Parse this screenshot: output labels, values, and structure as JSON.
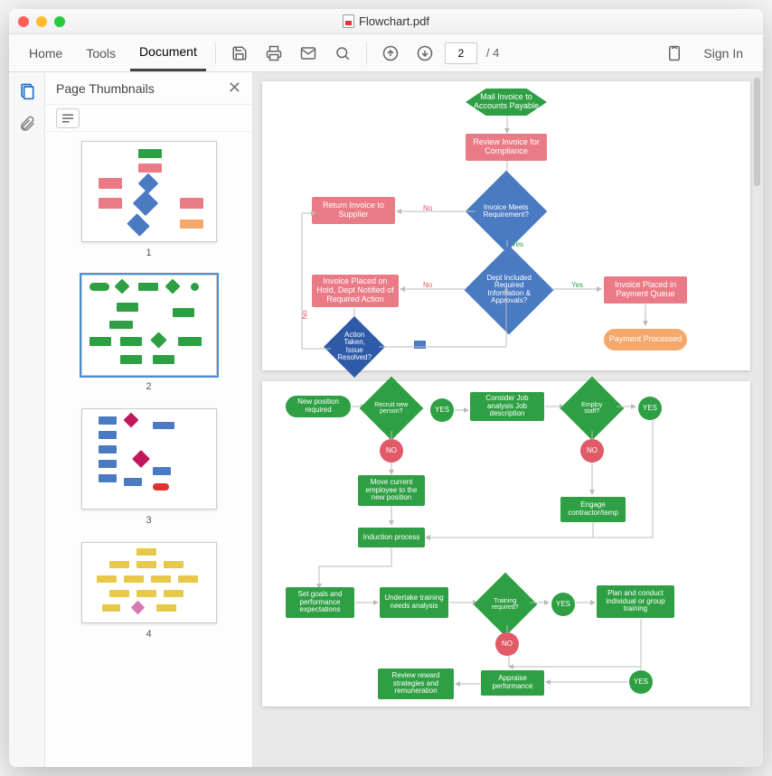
{
  "window": {
    "title": "Flowchart.pdf"
  },
  "nav": {
    "home": "Home",
    "tools": "Tools",
    "document": "Document",
    "signin": "Sign In"
  },
  "pager": {
    "current": "2",
    "total": "/ 4"
  },
  "sidebar": {
    "title": "Page Thumbnails"
  },
  "thumbs": {
    "n1": "1",
    "n2": "2",
    "n3": "3",
    "n4": "4"
  },
  "flow1": {
    "mail": "Mail Invoice to Accounts Payable",
    "review": "Review Invoice for Compliance",
    "return": "Return Invoice to Supplier",
    "meets": "Invoice Meets Requirement?",
    "hold": "Invoice Placed on Hold, Dept Notified of Required Action",
    "dept": "Dept Included Required Information & Approvals?",
    "queue": "Invoice Placed in Payment Queue",
    "action": "Action Taken, Issue Resolved?",
    "processed": "Payment Processed",
    "yes": "Yes",
    "no": "No"
  },
  "flow2": {
    "newpos": "New position required",
    "recruit": "Recruit new person?",
    "consider": "Consider Job analysis Job description",
    "employ": "Employ staff?",
    "yes": "YES",
    "no": "NO",
    "move": "Move current employee to the new position",
    "engage": "Engage contractor/temp",
    "induction": "Induction process",
    "goals": "Set goals and performance expectations",
    "needs": "Undertake training needs analysis",
    "training": "Training required?",
    "plan": "Plan and conduct individual or group training",
    "review": "Review reward strategies and remuneration",
    "appraise": "Appraise performance"
  }
}
